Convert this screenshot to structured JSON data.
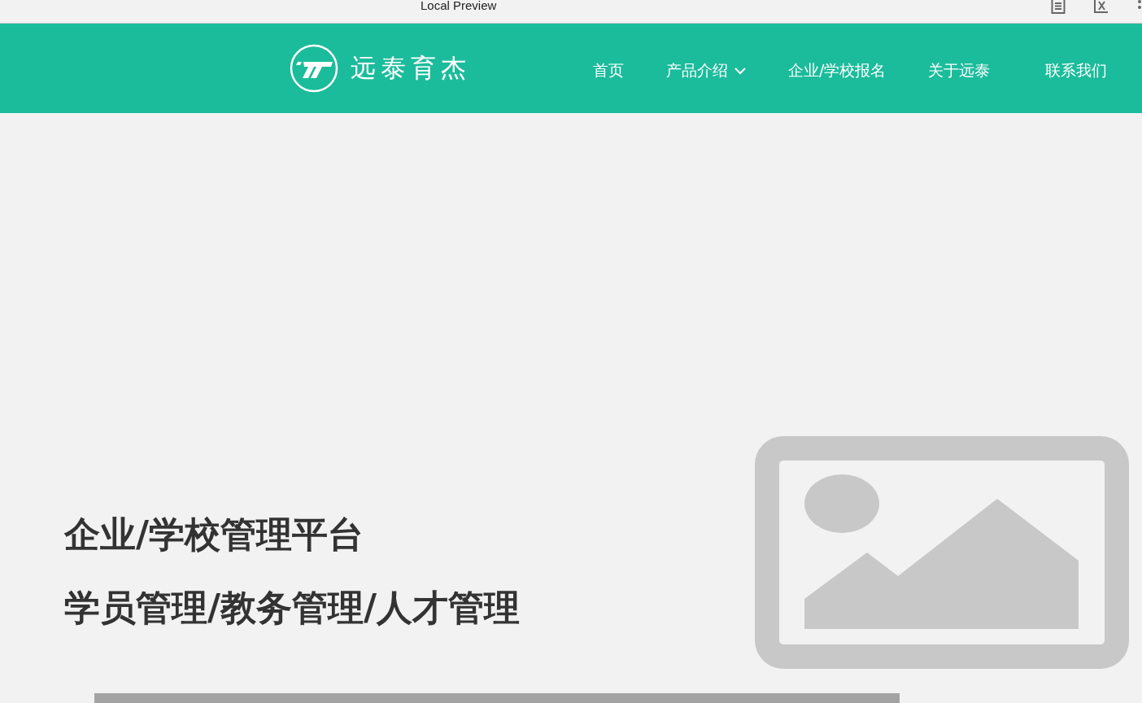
{
  "window": {
    "title": "Local Preview"
  },
  "header": {
    "logo_text": "远泰育杰",
    "nav": [
      {
        "label": "首页",
        "kind": "link"
      },
      {
        "label": "产品介绍",
        "kind": "dropdown"
      },
      {
        "label": "企业/学校报名",
        "kind": "link"
      },
      {
        "label": "关于远泰",
        "kind": "link"
      },
      {
        "label": "联系我们",
        "kind": "link"
      }
    ]
  },
  "hero": {
    "headings": [
      "企业/学校管理平台",
      "学员管理/教务管理/人才管理"
    ]
  }
}
